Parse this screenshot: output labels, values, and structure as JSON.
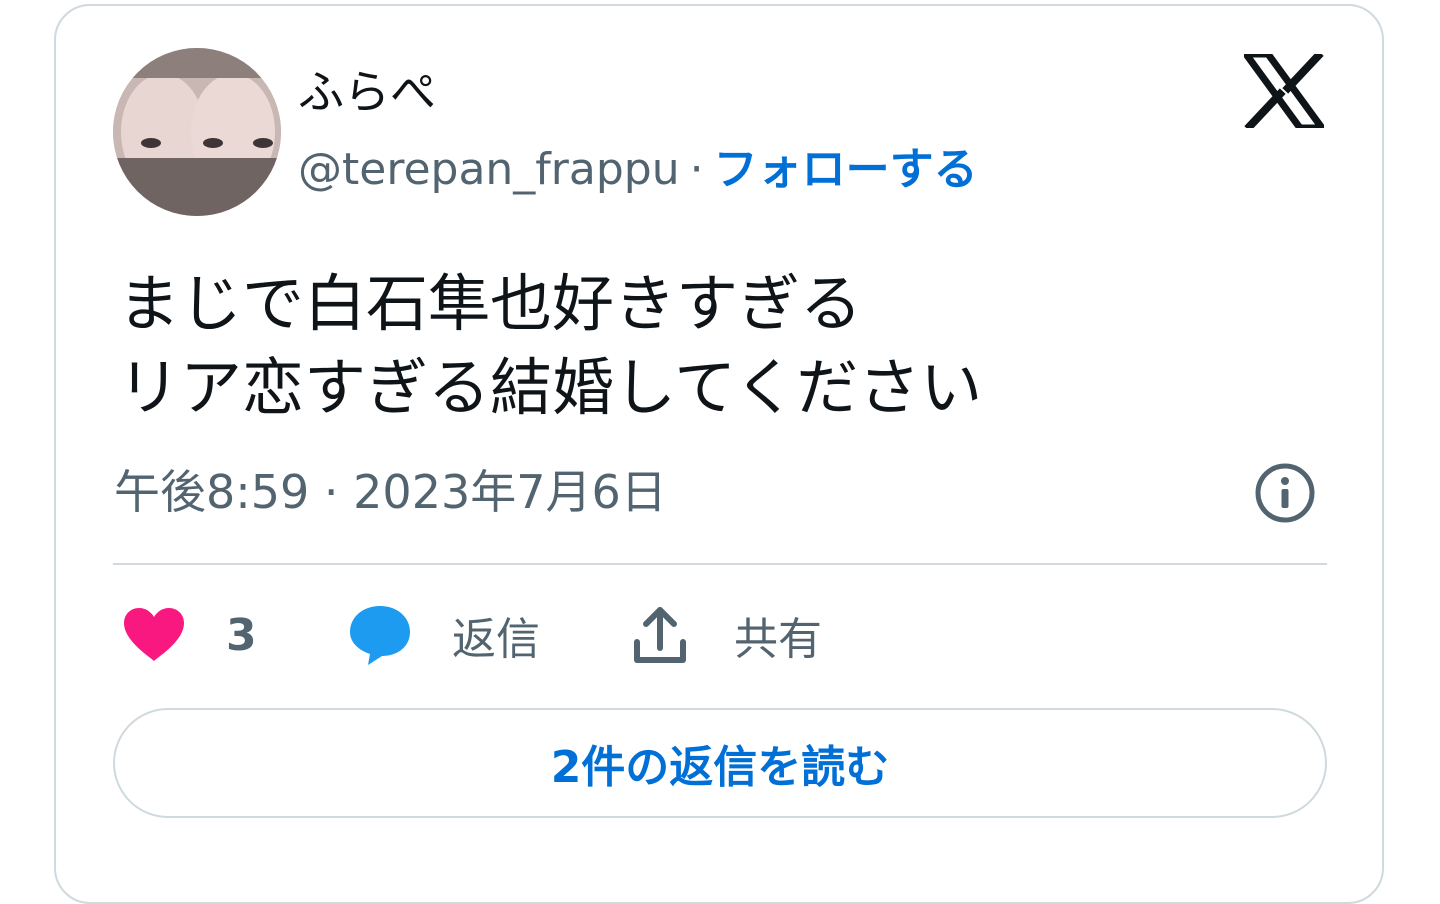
{
  "author": {
    "display_name": "ふらぺ",
    "handle": "@terepan_frappu",
    "separator": "·",
    "follow_label": "フォローする"
  },
  "tweet": {
    "lines": [
      "まじで白石隼也好きすぎる",
      "リア恋すぎる結婚してください"
    ],
    "timestamp": "午後8:59 · 2023年7月6日"
  },
  "actions": {
    "like_count": "3",
    "reply_label": "返信",
    "share_label": "共有"
  },
  "read_replies_label": "2件の返信を読む",
  "colors": {
    "link": "#006fd6",
    "like": "#f91880",
    "reply": "#1d9bf0",
    "muted": "#536471",
    "border": "#cfd9de"
  },
  "icons": [
    "x-logo-icon",
    "info-icon",
    "heart-icon",
    "speech-bubble-icon",
    "share-upload-icon"
  ]
}
